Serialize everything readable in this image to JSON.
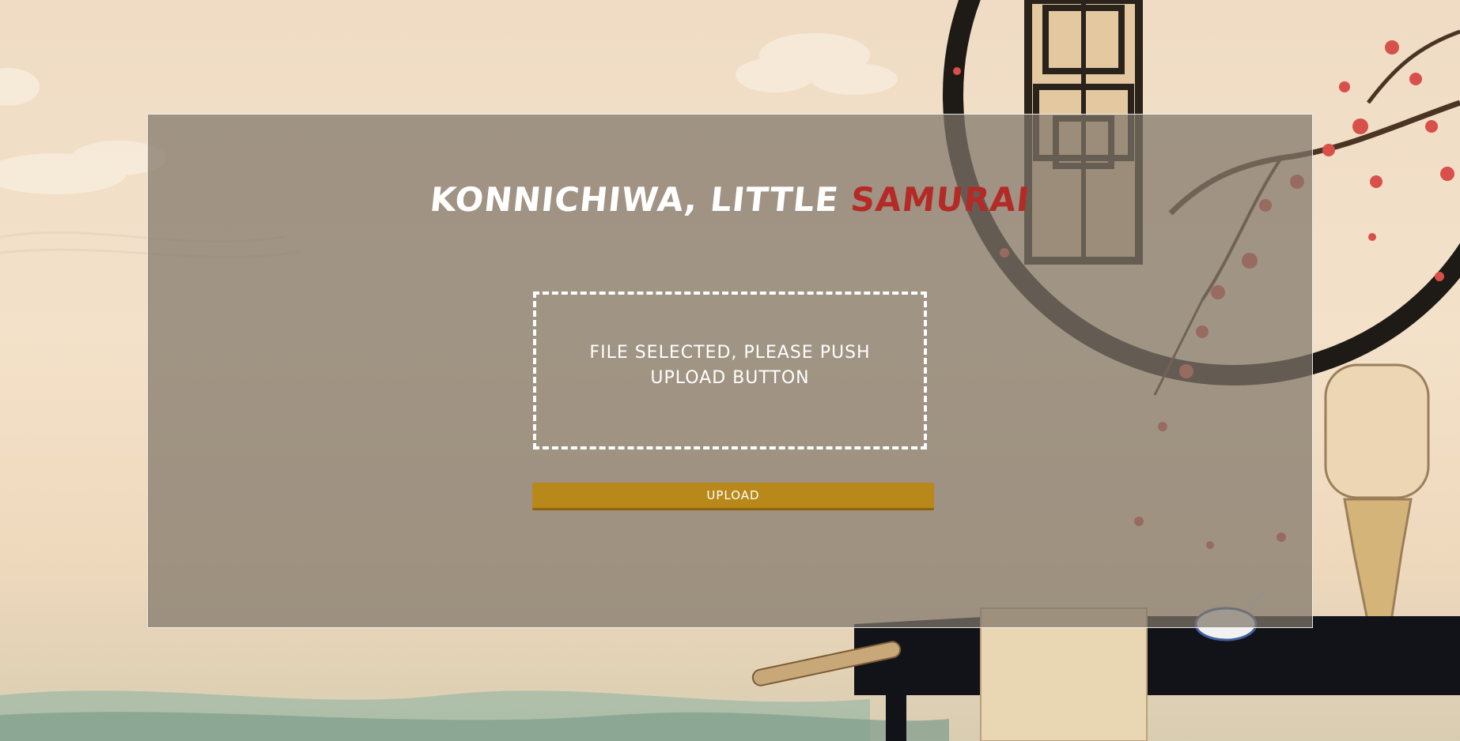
{
  "page": {
    "title_main": "KONNICHIWA, LITTLE ",
    "title_accent": "SAMURAI"
  },
  "dropzone": {
    "message": "FILE SELECTED, PLEASE PUSH UPLOAD BUTTON"
  },
  "actions": {
    "upload_label": "UPLOAD"
  },
  "colors": {
    "accent_red": "#b42a26",
    "button_gold": "#b9881a",
    "panel_overlay": "#80766a"
  }
}
